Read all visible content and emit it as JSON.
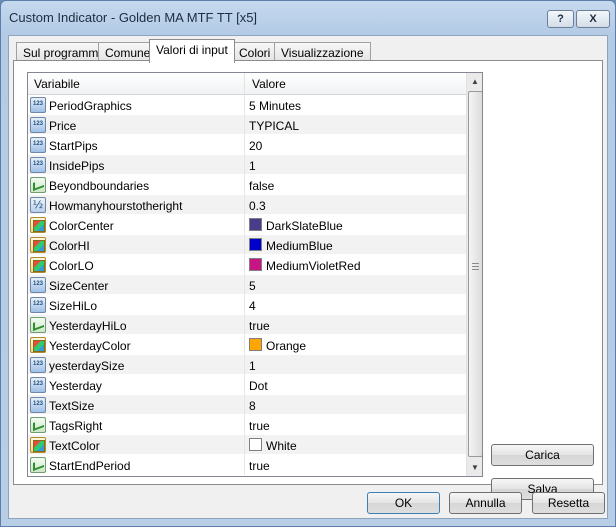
{
  "window": {
    "title": "Custom Indicator - Golden MA MTF TT [x5]",
    "help_label": "?",
    "close_label": "X"
  },
  "tabs": [
    {
      "label": "Sul programma"
    },
    {
      "label": "Comune"
    },
    {
      "label": "Valori di input",
      "active": true
    },
    {
      "label": "Colori"
    },
    {
      "label": "Visualizzazione"
    }
  ],
  "grid": {
    "col_variable": "Variabile",
    "col_value": "Valore",
    "rows": [
      {
        "name": "PeriodGraphics",
        "value": "5 Minutes",
        "type": "int-icon"
      },
      {
        "name": "Price",
        "value": "TYPICAL",
        "type": "int-icon"
      },
      {
        "name": "StartPips",
        "value": "20",
        "type": "int-icon"
      },
      {
        "name": "InsidePips",
        "value": "1",
        "type": "int-icon"
      },
      {
        "name": "Beyondboundaries",
        "value": "false",
        "type": "bool-icon"
      },
      {
        "name": "Howmanyhourstotheright",
        "value": "0.3",
        "type": "double-icon"
      },
      {
        "name": "ColorCenter",
        "value": "DarkSlateBlue",
        "type": "color-icon",
        "swatch": "#483d8b"
      },
      {
        "name": "ColorHI",
        "value": "MediumBlue",
        "type": "color-icon",
        "swatch": "#0000cd"
      },
      {
        "name": "ColorLO",
        "value": "MediumVioletRed",
        "type": "color-icon",
        "swatch": "#c71585"
      },
      {
        "name": "SizeCenter",
        "value": "5",
        "type": "int-icon"
      },
      {
        "name": "SizeHiLo",
        "value": "4",
        "type": "int-icon"
      },
      {
        "name": "YesterdayHiLo",
        "value": "true",
        "type": "bool-icon"
      },
      {
        "name": "YesterdayColor",
        "value": "Orange",
        "type": "color-icon",
        "swatch": "#ffa500"
      },
      {
        "name": "yesterdaySize",
        "value": "1",
        "type": "int-icon"
      },
      {
        "name": "Yesterday",
        "value": "Dot",
        "type": "int-icon"
      },
      {
        "name": "TextSize",
        "value": "8",
        "type": "int-icon"
      },
      {
        "name": "TagsRight",
        "value": "true",
        "type": "bool-icon"
      },
      {
        "name": "TextColor",
        "value": "White",
        "type": "color-icon",
        "swatch": "#ffffff"
      },
      {
        "name": "StartEndPeriod",
        "value": "true",
        "type": "bool-icon"
      }
    ]
  },
  "buttons": {
    "load": "Carica",
    "save": "Salva",
    "ok": "OK",
    "cancel": "Annulla",
    "reset": "Resetta"
  }
}
